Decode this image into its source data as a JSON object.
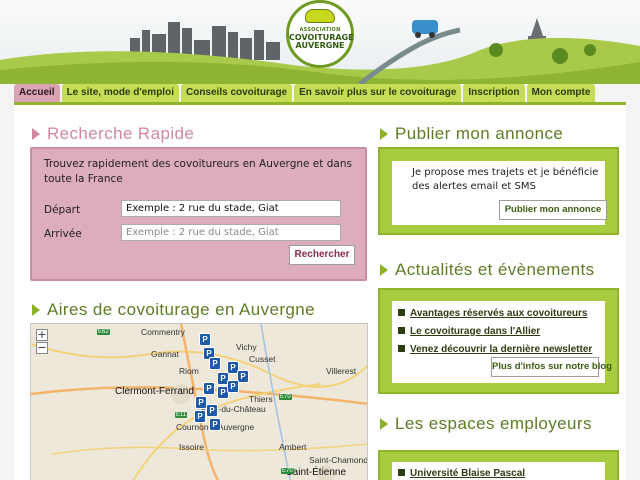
{
  "logo": {
    "line1": "ASSOCIATION",
    "line2": "COVOITURAGE",
    "line3": "AUVERGNE"
  },
  "nav": {
    "tabs": [
      {
        "label": "Accueil",
        "active": true
      },
      {
        "label": "Le site, mode d'emploi"
      },
      {
        "label": "Conseils covoiturage"
      },
      {
        "label": "En savoir plus sur le covoiturage"
      },
      {
        "label": "Inscription"
      },
      {
        "label": "Mon compte"
      }
    ]
  },
  "search": {
    "title": "Recherche Rapide",
    "intro": "Trouvez rapidement des covoitureurs en Auvergne et dans toute la France",
    "depart_label": "Départ",
    "depart_value": "Exemple : 2 rue du stade, Giat",
    "arrivee_label": "Arrivée",
    "arrivee_placeholder": "Exemple : 2 rue du stade, Giat",
    "button": "Rechercher"
  },
  "publish": {
    "title": "Publier mon annonce",
    "text": "Je propose mes trajets et je bénéficie des alertes email et SMS",
    "button": "Publier mon annonce"
  },
  "news": {
    "title": "Actualités et évènements",
    "items": [
      "Avantages réservés aux covoitureurs",
      "Le covoiturage dans l'Allier",
      "Venez découvrir la dernière newsletter"
    ],
    "button": "Plus d'infos sur notre blog"
  },
  "employers": {
    "title": "Les espaces employeurs",
    "items": [
      "Université Blaise Pascal"
    ]
  },
  "map": {
    "title": "Aires de covoiturage en Auvergne",
    "zoom_in": "+",
    "zoom_out": "−",
    "pin_label": "P",
    "cities": [
      "Commentry",
      "Vichy",
      "Cusset",
      "Gannat",
      "Riom",
      "Thiers",
      "Clermont-Ferrand",
      "Pont-du-Château",
      "Cournon-d'Auvergne",
      "Issoire",
      "Ambert",
      "Saint-Étienne",
      "Saint-Chamond",
      "Villerest"
    ],
    "roads": [
      "E62",
      "E11",
      "E70",
      "E70"
    ]
  },
  "colors": {
    "green": "#a8cc3f",
    "pink": "#ddacbe",
    "nav_active": "#d9a3b4",
    "pin": "#1e5aa8"
  }
}
